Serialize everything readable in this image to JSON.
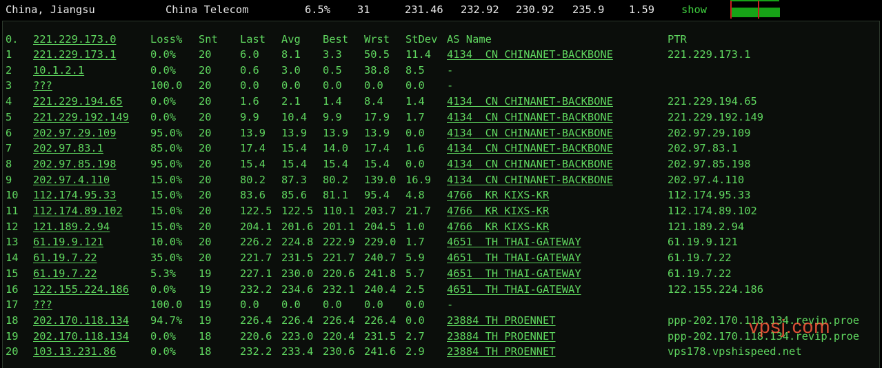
{
  "header": {
    "location": "China, Jiangsu",
    "isp": "China Telecom",
    "loss": "6.5%",
    "sent": "31",
    "last": "231.46",
    "avg": "232.92",
    "best": "230.92",
    "worst": "235.9",
    "stdev": "1.59",
    "show_label": "show"
  },
  "columns": {
    "hop": "0.",
    "host": "221.229.173.0",
    "loss": "Loss%",
    "snt": "Snt",
    "last": "Last",
    "avg": "Avg",
    "best": "Best",
    "wrst": "Wrst",
    "stdev": "StDev",
    "as": "AS Name",
    "ptr": "PTR"
  },
  "rows": [
    {
      "hop": "1",
      "host": "221.229.173.1",
      "loss": "0.0%",
      "snt": "20",
      "last": "6.0",
      "avg": "8.1",
      "best": "3.3",
      "wrst": "50.5",
      "stdev": "11.4",
      "as": "4134  CN CHINANET-BACKBONE",
      "ptr": "221.229.173.1"
    },
    {
      "hop": "2",
      "host": "10.1.2.1",
      "loss": "0.0%",
      "snt": "20",
      "last": "0.6",
      "avg": "3.0",
      "best": "0.5",
      "wrst": "38.8",
      "stdev": "8.5",
      "as": "-",
      "ptr": ""
    },
    {
      "hop": "3",
      "host": "???",
      "loss": "100.0",
      "snt": "20",
      "last": "0.0",
      "avg": "0.0",
      "best": "0.0",
      "wrst": "0.0",
      "stdev": "0.0",
      "as": "-",
      "ptr": ""
    },
    {
      "hop": "4",
      "host": "221.229.194.65",
      "loss": "0.0%",
      "snt": "20",
      "last": "1.6",
      "avg": "2.1",
      "best": "1.4",
      "wrst": "8.4",
      "stdev": "1.4",
      "as": "4134  CN CHINANET-BACKBONE",
      "ptr": "221.229.194.65"
    },
    {
      "hop": "5",
      "host": "221.229.192.149",
      "loss": "0.0%",
      "snt": "20",
      "last": "9.9",
      "avg": "10.4",
      "best": "9.9",
      "wrst": "17.9",
      "stdev": "1.7",
      "as": "4134  CN CHINANET-BACKBONE",
      "ptr": "221.229.192.149"
    },
    {
      "hop": "6",
      "host": "202.97.29.109",
      "loss": "95.0%",
      "snt": "20",
      "last": "13.9",
      "avg": "13.9",
      "best": "13.9",
      "wrst": "13.9",
      "stdev": "0.0",
      "as": "4134  CN CHINANET-BACKBONE",
      "ptr": "202.97.29.109"
    },
    {
      "hop": "7",
      "host": "202.97.83.1",
      "loss": "85.0%",
      "snt": "20",
      "last": "17.4",
      "avg": "15.4",
      "best": "14.0",
      "wrst": "17.4",
      "stdev": "1.6",
      "as": "4134  CN CHINANET-BACKBONE",
      "ptr": "202.97.83.1"
    },
    {
      "hop": "8",
      "host": "202.97.85.198",
      "loss": "95.0%",
      "snt": "20",
      "last": "15.4",
      "avg": "15.4",
      "best": "15.4",
      "wrst": "15.4",
      "stdev": "0.0",
      "as": "4134  CN CHINANET-BACKBONE",
      "ptr": "202.97.85.198"
    },
    {
      "hop": "9",
      "host": "202.97.4.110",
      "loss": "15.0%",
      "snt": "20",
      "last": "80.2",
      "avg": "87.3",
      "best": "80.2",
      "wrst": "139.0",
      "stdev": "16.9",
      "as": "4134  CN CHINANET-BACKBONE",
      "ptr": "202.97.4.110"
    },
    {
      "hop": "10",
      "host": "112.174.95.33",
      "loss": "15.0%",
      "snt": "20",
      "last": "83.6",
      "avg": "85.6",
      "best": "81.1",
      "wrst": "95.4",
      "stdev": "4.8",
      "as": "4766  KR KIXS-KR",
      "ptr": "112.174.95.33"
    },
    {
      "hop": "11",
      "host": "112.174.89.102",
      "loss": "15.0%",
      "snt": "20",
      "last": "122.5",
      "avg": "122.5",
      "best": "110.1",
      "wrst": "203.7",
      "stdev": "21.7",
      "as": "4766  KR KIXS-KR",
      "ptr": "112.174.89.102"
    },
    {
      "hop": "12",
      "host": "121.189.2.94",
      "loss": "15.0%",
      "snt": "20",
      "last": "204.1",
      "avg": "201.6",
      "best": "201.1",
      "wrst": "204.5",
      "stdev": "1.0",
      "as": "4766  KR KIXS-KR",
      "ptr": "121.189.2.94"
    },
    {
      "hop": "13",
      "host": "61.19.9.121",
      "loss": "10.0%",
      "snt": "20",
      "last": "226.2",
      "avg": "224.8",
      "best": "222.9",
      "wrst": "229.0",
      "stdev": "1.7",
      "as": "4651  TH THAI-GATEWAY",
      "ptr": "61.19.9.121"
    },
    {
      "hop": "14",
      "host": "61.19.7.22",
      "loss": "35.0%",
      "snt": "20",
      "last": "221.7",
      "avg": "231.5",
      "best": "221.7",
      "wrst": "240.7",
      "stdev": "5.9",
      "as": "4651  TH THAI-GATEWAY",
      "ptr": "61.19.7.22"
    },
    {
      "hop": "15",
      "host": "61.19.7.22",
      "loss": "5.3%",
      "snt": "19",
      "last": "227.1",
      "avg": "230.0",
      "best": "220.6",
      "wrst": "241.8",
      "stdev": "5.7",
      "as": "4651  TH THAI-GATEWAY",
      "ptr": "61.19.7.22"
    },
    {
      "hop": "16",
      "host": "122.155.224.186",
      "loss": "0.0%",
      "snt": "19",
      "last": "232.2",
      "avg": "234.6",
      "best": "232.1",
      "wrst": "240.4",
      "stdev": "2.5",
      "as": "4651  TH THAI-GATEWAY",
      "ptr": "122.155.224.186"
    },
    {
      "hop": "17",
      "host": "???",
      "loss": "100.0",
      "snt": "19",
      "last": "0.0",
      "avg": "0.0",
      "best": "0.0",
      "wrst": "0.0",
      "stdev": "0.0",
      "as": "-",
      "ptr": ""
    },
    {
      "hop": "18",
      "host": "202.170.118.134",
      "loss": "94.7%",
      "snt": "19",
      "last": "226.4",
      "avg": "226.4",
      "best": "226.4",
      "wrst": "226.4",
      "stdev": "0.0",
      "as": "23884 TH PROENNET",
      "ptr": "ppp-202.170.118.134.revip.proe"
    },
    {
      "hop": "19",
      "host": "202.170.118.134",
      "loss": "0.0%",
      "snt": "18",
      "last": "220.6",
      "avg": "223.0",
      "best": "220.4",
      "wrst": "231.5",
      "stdev": "2.7",
      "as": "23884 TH PROENNET",
      "ptr": "ppp-202.170.118.134.revip.proe"
    },
    {
      "hop": "20",
      "host": "103.13.231.86",
      "loss": "0.0%",
      "snt": "18",
      "last": "232.2",
      "avg": "233.4",
      "best": "230.6",
      "wrst": "241.6",
      "stdev": "2.9",
      "as": "23884 TH PROENNET",
      "ptr": "vps178.vpshispeed.net"
    }
  ],
  "mini_chart": {
    "fill_fraction": 0.94,
    "bar_color": "#17a317",
    "marker_color": "#cc1f1f"
  },
  "watermark": "vpsj.com"
}
